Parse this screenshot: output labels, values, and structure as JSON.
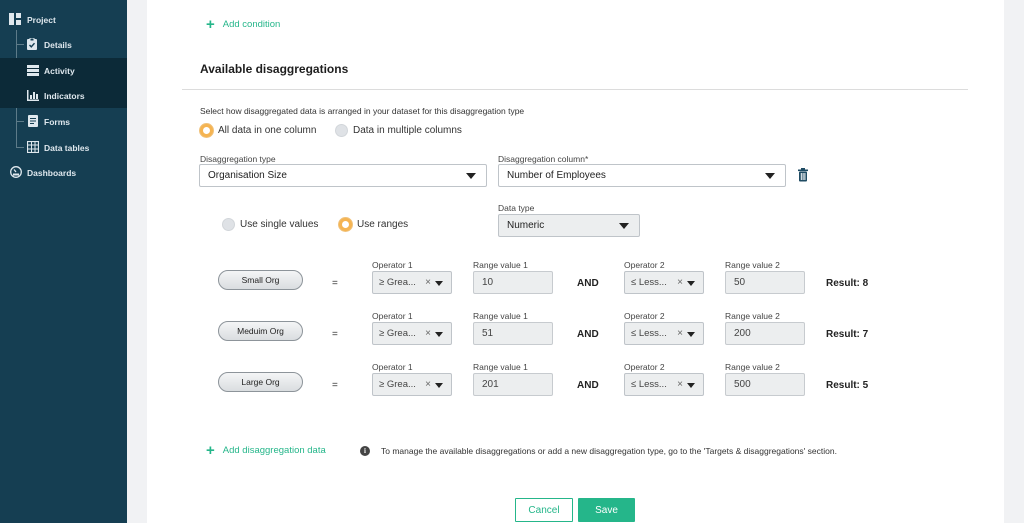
{
  "sidebar": {
    "project": "Project",
    "details": "Details",
    "activity": "Activity",
    "indicators": "Indicators",
    "forms": "Forms",
    "data_tables": "Data tables",
    "dashboards": "Dashboards"
  },
  "main": {
    "add_condition": "Add condition",
    "section_title": "Available disaggregations",
    "hint": "Select how disaggregated data is arranged in your dataset for this disaggregation type",
    "arrangement_options": [
      "All data in one column",
      "Data in multiple columns"
    ],
    "arrangement_selected": "All data in one column",
    "disaggregation_type_label": "Disaggregation type",
    "disaggregation_type_value": "Organisation Size",
    "disaggregation_column_label": "Disaggregation column*",
    "disaggregation_column_value": "Number of Employees",
    "value_modes": [
      "Use single values",
      "Use ranges"
    ],
    "value_mode_selected": "Use ranges",
    "data_type_label": "Data type",
    "data_type_value": "Numeric",
    "labels": {
      "operator1": "Operator 1",
      "range1": "Range value 1",
      "operator2": "Operator 2",
      "range2": "Range value 2",
      "equals": "=",
      "and": "AND"
    },
    "rows": [
      {
        "name": "Small Org",
        "op1": "≥ Grea...",
        "v1": "10",
        "op2": "≤ Less...",
        "v2": "50",
        "result": "Result: 8"
      },
      {
        "name": "Meduim Org",
        "op1": "≥ Grea...",
        "v1": "51",
        "op2": "≤ Less...",
        "v2": "200",
        "result": "Result: 7"
      },
      {
        "name": "Large Org",
        "op1": "≥ Grea...",
        "v1": "201",
        "op2": "≤ Less...",
        "v2": "500",
        "result": "Result: 5"
      }
    ],
    "add_data": "Add disaggregation data",
    "info_text": "To manage the available disaggregations or add a new disaggregation type, go to the 'Targets & disaggregations' section.",
    "cancel": "Cancel",
    "save": "Save"
  },
  "colors": {
    "sidebar_bg": "#153e52",
    "sidebar_active": "#0c2a38",
    "accent_green": "#25b68a",
    "radio_orange": "#f5b452"
  }
}
